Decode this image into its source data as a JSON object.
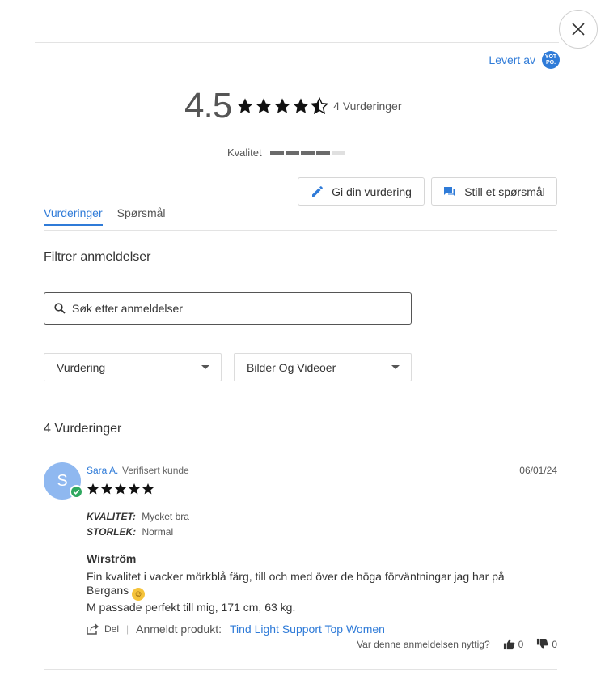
{
  "powered_by": {
    "text": "Levert av",
    "logo_text": "YOT PO."
  },
  "summary": {
    "average": "4.5",
    "stars": 4.5,
    "total_text": "4 Vurderinger",
    "quality_label": "Kvalitet",
    "quality_level_segments": 4,
    "quality_total_segments": 5
  },
  "actions": {
    "write_review": "Gi din vurdering",
    "ask_question": "Still et spørsmål"
  },
  "tabs": [
    {
      "label": "Vurderinger",
      "active": true
    },
    {
      "label": "Spørsmål",
      "active": false
    }
  ],
  "filters": {
    "title": "Filtrer anmeldelser",
    "search_placeholder": "Søk etter anmeldelser",
    "rating_select": "Vurdering",
    "media_select": "Bilder Og Videoer"
  },
  "reviews_count_title": "4 Vurderinger",
  "reviews": [
    {
      "avatar_letter": "S",
      "name": "Sara A.",
      "verified": "Verifisert kunde",
      "date": "06/01/24",
      "stars": 5,
      "attributes": [
        {
          "key": "KVALITET:",
          "value": "Mycket bra"
        },
        {
          "key": "STORLEK:",
          "value": "Normal"
        }
      ],
      "title": "Wirström",
      "body_line1": "Fin kvalitet i vacker mörkblå färg, till och med över de höga förväntningar jag har på Bergans",
      "body_line2": "M passade perfekt till mig, 171 cm, 63 kg.",
      "share_label": "Del",
      "reviewed_product_label": "Anmeldt produkt:",
      "product_name": "Tind Light Support Top Women",
      "helpful_question": "Var denne anmeldelsen nyttig?",
      "votes_up": "0",
      "votes_down": "0"
    }
  ],
  "colors": {
    "accent": "#2f7bd8",
    "verified": "#2fa860",
    "avatar": "#8fb8f0"
  }
}
